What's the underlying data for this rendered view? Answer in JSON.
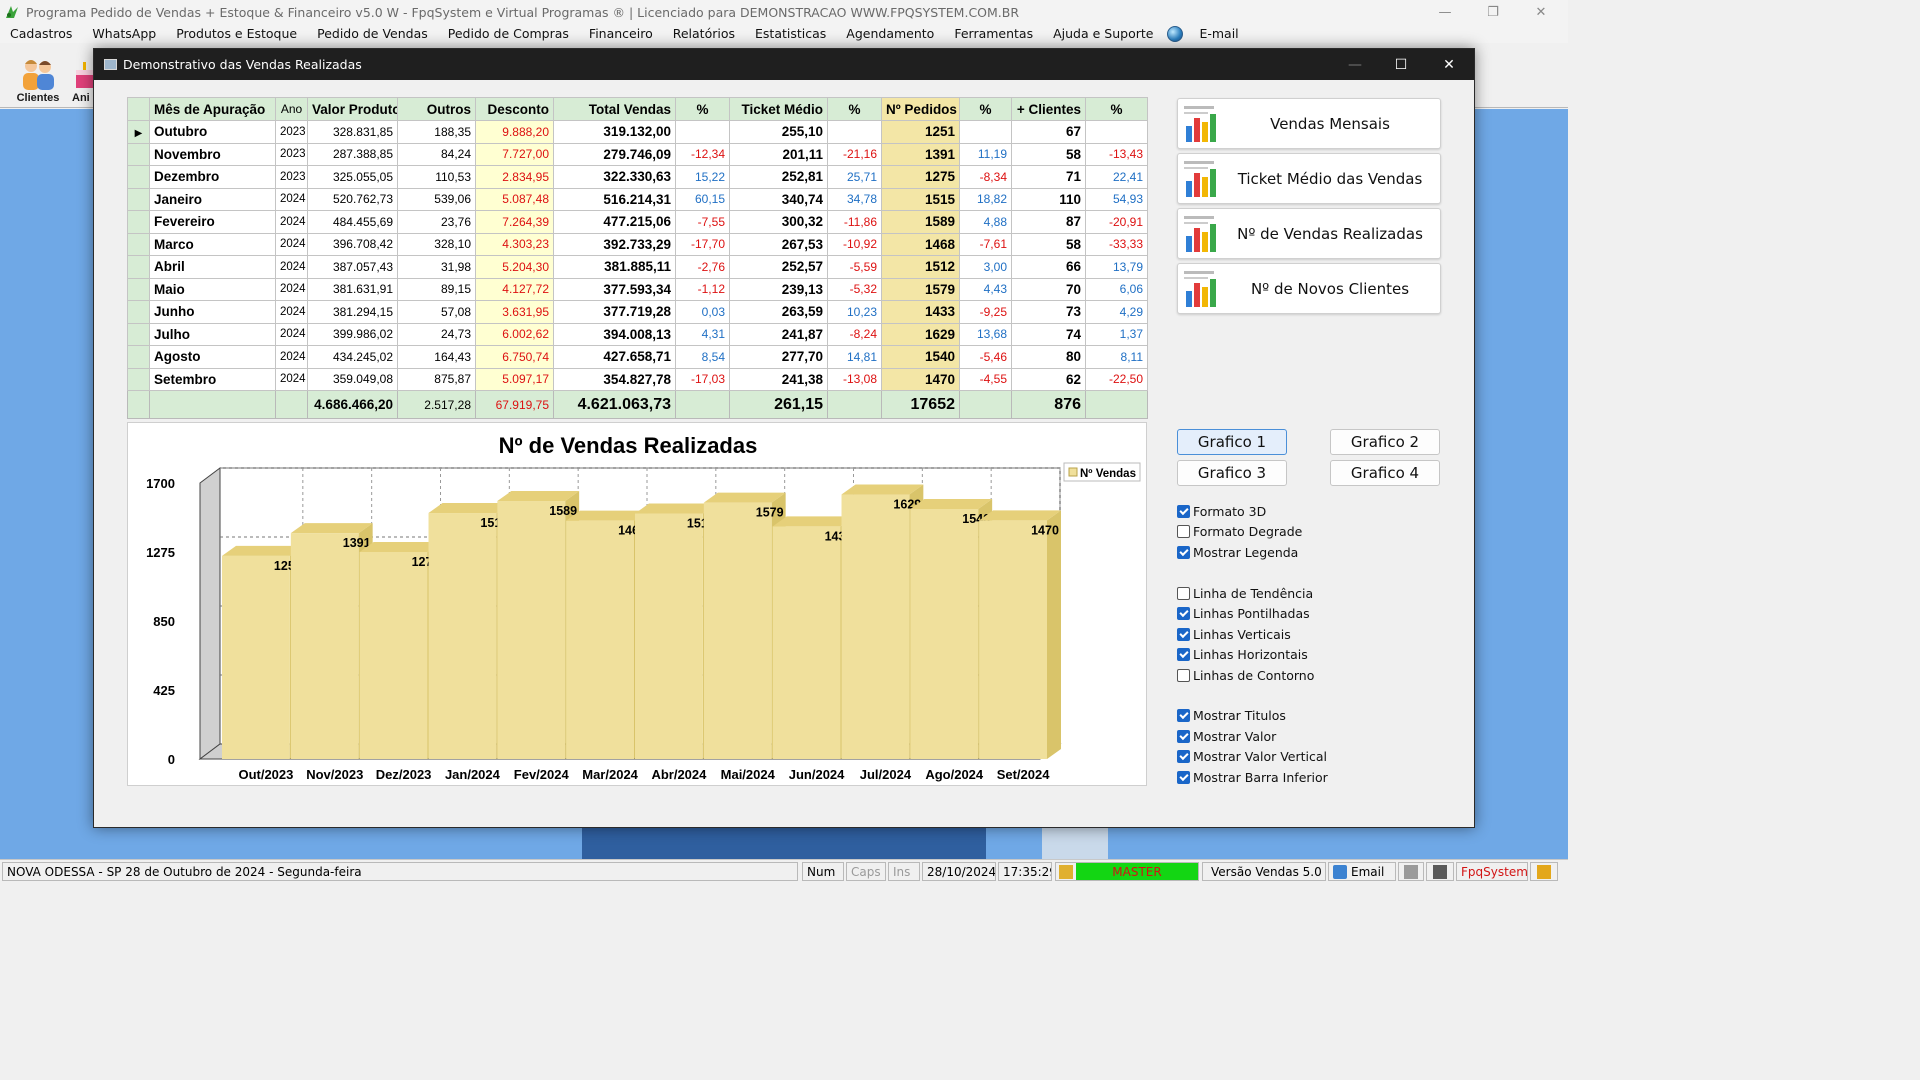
{
  "app": {
    "title": "Programa Pedido de Vendas + Estoque & Financeiro v5.0 W - FpqSystem e Virtual Programas ® | Licenciado para  DEMONSTRACAO WWW.FPQSYSTEM.COM.BR",
    "menu": [
      "Cadastros",
      "WhatsApp",
      "Produtos e Estoque",
      "Pedido de Vendas",
      "Pedido de Compras",
      "Financeiro",
      "Relatórios",
      "Estatisticas",
      "Agendamento",
      "Ferramentas",
      "Ajuda e Suporte",
      "E-mail"
    ],
    "toolbar": {
      "clientes": "Clientes",
      "partial": "Ani"
    }
  },
  "dialog": {
    "title": "Demonstrativo das Vendas Realizadas",
    "grid": {
      "headers": [
        "Mês de Apuração",
        "Ano",
        "Valor Produto",
        "Outros",
        "Desconto",
        "Total Vendas",
        "%",
        "Ticket Médio",
        "%",
        "Nº Pedidos",
        "%",
        "+ Clientes",
        "%"
      ],
      "rows": [
        [
          "Outubro",
          "2023",
          "328.831,85",
          "188,35",
          "9.888,20",
          "319.132,00",
          "",
          "255,10",
          "",
          "1251",
          "",
          "67",
          ""
        ],
        [
          "Novembro",
          "2023",
          "287.388,85",
          "84,24",
          "7.727,00",
          "279.746,09",
          "-12,34",
          "201,11",
          "-21,16",
          "1391",
          "11,19",
          "58",
          "-13,43"
        ],
        [
          "Dezembro",
          "2023",
          "325.055,05",
          "110,53",
          "2.834,95",
          "322.330,63",
          "15,22",
          "252,81",
          "25,71",
          "1275",
          "-8,34",
          "71",
          "22,41"
        ],
        [
          "Janeiro",
          "2024",
          "520.762,73",
          "539,06",
          "5.087,48",
          "516.214,31",
          "60,15",
          "340,74",
          "34,78",
          "1515",
          "18,82",
          "110",
          "54,93"
        ],
        [
          "Fevereiro",
          "2024",
          "484.455,69",
          "23,76",
          "7.264,39",
          "477.215,06",
          "-7,55",
          "300,32",
          "-11,86",
          "1589",
          "4,88",
          "87",
          "-20,91"
        ],
        [
          "Marco",
          "2024",
          "396.708,42",
          "328,10",
          "4.303,23",
          "392.733,29",
          "-17,70",
          "267,53",
          "-10,92",
          "1468",
          "-7,61",
          "58",
          "-33,33"
        ],
        [
          "Abril",
          "2024",
          "387.057,43",
          "31,98",
          "5.204,30",
          "381.885,11",
          "-2,76",
          "252,57",
          "-5,59",
          "1512",
          "3,00",
          "66",
          "13,79"
        ],
        [
          "Maio",
          "2024",
          "381.631,91",
          "89,15",
          "4.127,72",
          "377.593,34",
          "-1,12",
          "239,13",
          "-5,32",
          "1579",
          "4,43",
          "70",
          "6,06"
        ],
        [
          "Junho",
          "2024",
          "381.294,15",
          "57,08",
          "3.631,95",
          "377.719,28",
          "0,03",
          "263,59",
          "10,23",
          "1433",
          "-9,25",
          "73",
          "4,29"
        ],
        [
          "Julho",
          "2024",
          "399.986,02",
          "24,73",
          "6.002,62",
          "394.008,13",
          "4,31",
          "241,87",
          "-8,24",
          "1629",
          "13,68",
          "74",
          "1,37"
        ],
        [
          "Agosto",
          "2024",
          "434.245,02",
          "164,43",
          "6.750,74",
          "427.658,71",
          "8,54",
          "277,70",
          "14,81",
          "1540",
          "-5,46",
          "80",
          "8,11"
        ],
        [
          "Setembro",
          "2024",
          "359.049,08",
          "875,87",
          "5.097,17",
          "354.827,78",
          "-17,03",
          "241,38",
          "-13,08",
          "1470",
          "-4,55",
          "62",
          "-22,50"
        ]
      ],
      "totals": [
        "",
        "",
        "4.686.466,20",
        "2.517,28",
        "67.919,75",
        "4.621.063,73",
        "",
        "261,15",
        "",
        "17652",
        "",
        "876",
        ""
      ]
    },
    "report_buttons": [
      "Vendas Mensais",
      "Ticket Médio das Vendas",
      "Nº de Vendas Realizadas",
      "Nº de Novos Clientes"
    ],
    "graph_buttons": [
      "Grafico 1",
      "Grafico 2",
      "Grafico 3",
      "Grafico 4"
    ],
    "options": [
      {
        "label": "Formato 3D",
        "checked": true
      },
      {
        "label": "Formato Degrade",
        "checked": false
      },
      {
        "label": "Mostrar Legenda",
        "checked": true
      },
      {
        "label": "Linha de Tendência",
        "checked": false
      },
      {
        "label": "Linhas Pontilhadas",
        "checked": true
      },
      {
        "label": "Linhas Verticais",
        "checked": true
      },
      {
        "label": "Linhas Horizontais",
        "checked": true
      },
      {
        "label": "Linhas de Contorno",
        "checked": false
      },
      {
        "label": "Mostrar Titulos",
        "checked": true
      },
      {
        "label": "Mostrar Valor",
        "checked": true
      },
      {
        "label": "Mostrar Valor Vertical",
        "checked": true
      },
      {
        "label": "Mostrar Barra Inferior",
        "checked": true
      }
    ],
    "chart_data": {
      "type": "bar",
      "title": "Nº de Vendas Realizadas",
      "categories": [
        "Out/2023",
        "Nov/2023",
        "Dez/2023",
        "Jan/2024",
        "Fev/2024",
        "Mar/2024",
        "Abr/2024",
        "Mai/2024",
        "Jun/2024",
        "Jul/2024",
        "Ago/2024",
        "Set/2024"
      ],
      "series": [
        {
          "name": "Nº Vendas",
          "values": [
            1251,
            1391,
            1275,
            1515,
            1589,
            1468,
            1512,
            1579,
            1433,
            1629,
            1540,
            1470
          ]
        }
      ],
      "ylim": [
        0,
        1700
      ],
      "yticks": [
        0,
        425,
        850,
        1275,
        1700
      ],
      "xlabel": "",
      "ylabel": "",
      "grid": true,
      "legend": "top-right",
      "bar_color": "#f0e09c"
    }
  },
  "statusbar": {
    "location": "NOVA ODESSA - SP 28 de Outubro de 2024 - Segunda-feira",
    "num": "Num",
    "caps": "Caps",
    "ins": "Ins",
    "date": "28/10/2024",
    "time": "17:35:29",
    "user": "MASTER",
    "version": "Versão Vendas 5.0",
    "email": "Email",
    "brand": "FpqSystem"
  }
}
